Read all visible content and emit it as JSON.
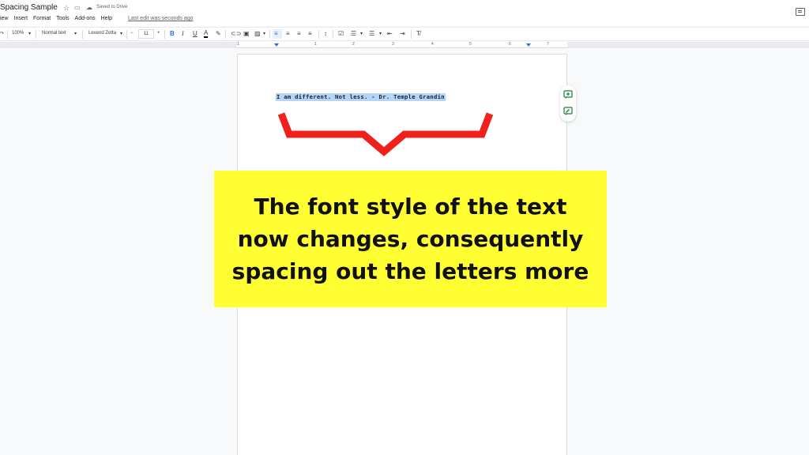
{
  "doc": {
    "title": "Spacing Sample",
    "saved_status": "Saved to Drive",
    "last_edit": "Last edit was seconds ago"
  },
  "menu": [
    "iew",
    "Insert",
    "Format",
    "Tools",
    "Add-ons",
    "Help"
  ],
  "toolbar": {
    "zoom": "100%",
    "style": "Normal text",
    "font": "Lexend Zetta",
    "font_size": "11",
    "minus": "−",
    "plus": "+",
    "bold": "B",
    "italic": "I",
    "underline": "U",
    "text_color": "A"
  },
  "ruler": [
    "1",
    "1",
    "2",
    "3",
    "4",
    "5",
    "6",
    "7"
  ],
  "document": {
    "quote": "I am different. Not less. - Dr. Temple Grandin"
  },
  "annotation": {
    "text": "The font style of the text now changes, consequently spacing out the letters more",
    "bg_color": "#ffff33",
    "brace_color": "#f0201a"
  },
  "icons": [
    "star-icon",
    "folder-icon",
    "cloud-icon",
    "comment-history-icon",
    "add-comment-icon",
    "suggest-edit-icon"
  ]
}
